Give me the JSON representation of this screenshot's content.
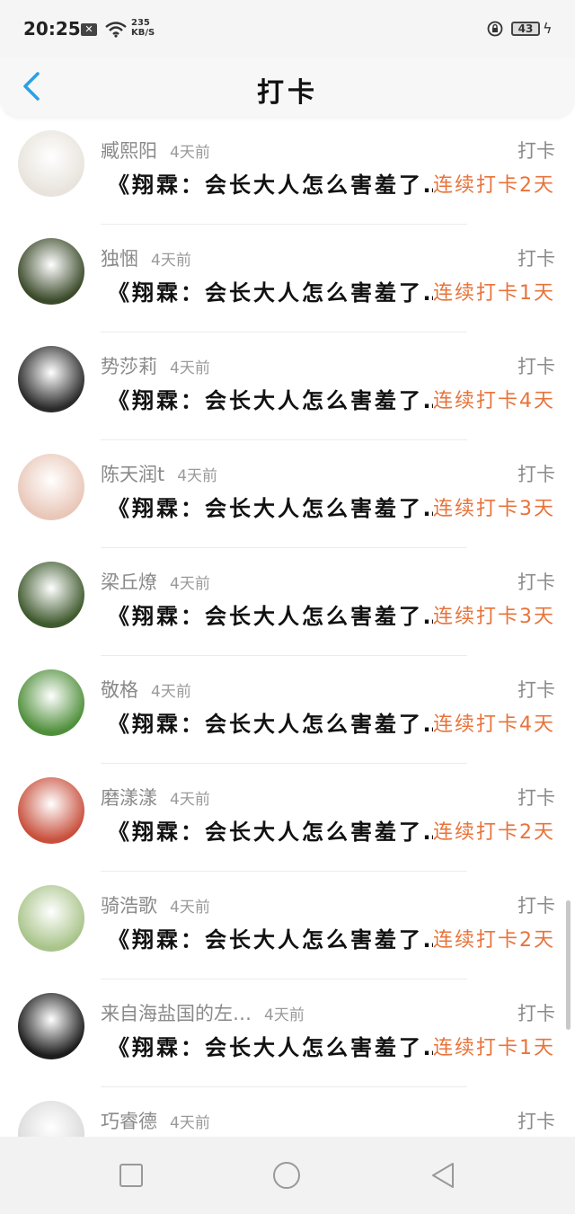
{
  "status_bar": {
    "time": "20:25",
    "notification": "✕",
    "net_speed_value": "235",
    "net_speed_unit": "KB/S",
    "battery": "43"
  },
  "header": {
    "title": "打卡"
  },
  "rows": [
    {
      "name": "臧熙阳",
      "time": "4天前",
      "action": "打卡",
      "content": "《翔霖：会长大人怎么害羞了…",
      "streak": "连续打卡2天",
      "avatar_color": "#e8e3dc"
    },
    {
      "name": "独悃",
      "time": "4天前",
      "action": "打卡",
      "content": "《翔霖：会长大人怎么害羞了…",
      "streak": "连续打卡1天",
      "avatar_color": "#3b4a2a"
    },
    {
      "name": "势莎莉",
      "time": "4天前",
      "action": "打卡",
      "content": "《翔霖：会长大人怎么害羞了…",
      "streak": "连续打卡4天",
      "avatar_color": "#2a2a2a"
    },
    {
      "name": "陈天润t",
      "time": "4天前",
      "action": "打卡",
      "content": "《翔霖：会长大人怎么害羞了…",
      "streak": "连续打卡3天",
      "avatar_color": "#e9c7b8"
    },
    {
      "name": "梁丘燎",
      "time": "4天前",
      "action": "打卡",
      "content": "《翔霖：会长大人怎么害羞了…",
      "streak": "连续打卡3天",
      "avatar_color": "#3f5a2e"
    },
    {
      "name": "敬格",
      "time": "4天前",
      "action": "打卡",
      "content": "《翔霖：会长大人怎么害羞了…",
      "streak": "连续打卡4天",
      "avatar_color": "#4f8f3a"
    },
    {
      "name": "磨漾漾",
      "time": "4天前",
      "action": "打卡",
      "content": "《翔霖：会长大人怎么害羞了…",
      "streak": "连续打卡2天",
      "avatar_color": "#c8503c"
    },
    {
      "name": "骑浩歌",
      "time": "4天前",
      "action": "打卡",
      "content": "《翔霖：会长大人怎么害羞了…",
      "streak": "连续打卡2天",
      "avatar_color": "#a9c48a"
    },
    {
      "name": "来自海盐国的左…",
      "time": "4天前",
      "action": "打卡",
      "content": "《翔霖：会长大人怎么害羞了…",
      "streak": "连续打卡1天",
      "avatar_color": "#1c1c1c"
    },
    {
      "name": "巧睿德",
      "time": "4天前",
      "action": "打卡",
      "content": "",
      "streak": "",
      "avatar_color": "#dadada"
    }
  ]
}
